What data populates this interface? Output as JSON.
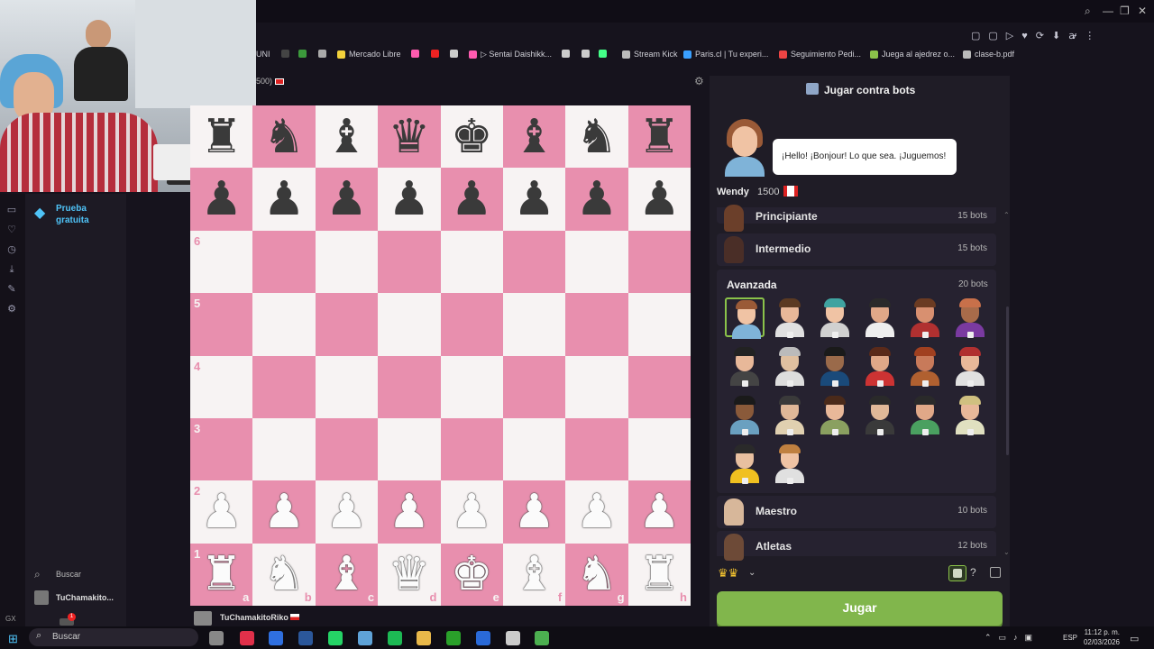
{
  "browser": {
    "bookmarks": [
      {
        "label": "UNI",
        "color": "#9c5b9c"
      },
      {
        "label": "",
        "color": "#444"
      },
      {
        "label": "",
        "color": "#3c9a3c"
      },
      {
        "label": "",
        "color": "#aaa"
      },
      {
        "label": "Mercado Libre",
        "color": "#f2d13b"
      },
      {
        "label": "",
        "color": "#ff5bb0"
      },
      {
        "label": "",
        "color": "#e22"
      },
      {
        "label": "",
        "color": "#ccc"
      },
      {
        "label": "▷ Sentai Daishikk...",
        "color": "#ff5bb0"
      },
      {
        "label": "",
        "color": "#ccc"
      },
      {
        "label": "",
        "color": "#ccc"
      },
      {
        "label": "",
        "color": "#4f8"
      },
      {
        "label": "Stream Kick",
        "color": "#bbb"
      },
      {
        "label": "Paris.cl | Tu experi...",
        "color": "#3aa0ff"
      },
      {
        "label": "Seguimiento Pedi...",
        "color": "#e44"
      },
      {
        "label": "Juega al ajedrez o...",
        "color": "#8bc34a"
      },
      {
        "label": "clase-b.pdf",
        "color": "#bbb"
      }
    ],
    "title_fragment": "500)"
  },
  "left_sidebar": {
    "premium_label_1": "Prueba",
    "premium_label_2": "gratuita",
    "search_label": "Buscar",
    "user_label": "TuChamakito...",
    "notification_count": "1",
    "gx_label": "GX"
  },
  "board": {
    "rank_labels": [
      "6",
      "5",
      "4",
      "3",
      "2",
      "1"
    ],
    "file_labels": [
      "a",
      "b",
      "c",
      "d",
      "e",
      "f",
      "g",
      "h"
    ],
    "player_name": "TuChamakitoRiko"
  },
  "panel": {
    "title": "Jugar contra bots",
    "speech": "¡Hello! ¡Bonjour! Lo que sea. ¡Juguemos!",
    "selected_bot": {
      "name": "Wendy",
      "rating": "1500"
    },
    "categories": [
      {
        "label": "Principiante",
        "count": "15 bots"
      },
      {
        "label": "Intermedio",
        "count": "15 bots"
      },
      {
        "label": "Avanzada",
        "count": "20 bots"
      },
      {
        "label": "Maestro",
        "count": "10 bots"
      },
      {
        "label": "Atletas",
        "count": "12 bots"
      }
    ],
    "play_button": "Jugar"
  },
  "taskbar": {
    "search_label": "Buscar",
    "language": "ESP",
    "time": "11:12 p. m.",
    "date": "02/03/2026"
  }
}
